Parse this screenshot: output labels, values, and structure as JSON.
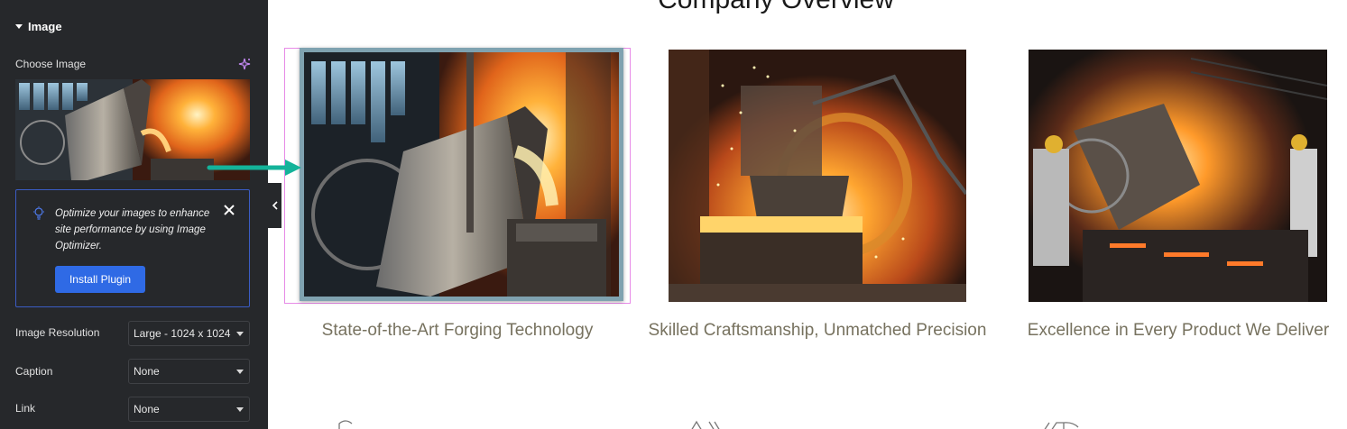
{
  "panel": {
    "section_title": "Image",
    "choose_image_label": "Choose Image",
    "notice": {
      "text": "Optimize your images to enhance site performance by using Image Optimizer.",
      "button_label": "Install Plugin"
    },
    "controls": [
      {
        "label": "Image Resolution",
        "value": "Large - 1024 x 1024"
      },
      {
        "label": "Caption",
        "value": "None"
      },
      {
        "label": "Link",
        "value": "None"
      }
    ]
  },
  "canvas": {
    "heading": "Company Overview",
    "cards": [
      {
        "caption": "State-of-the-Art Forging Technology"
      },
      {
        "caption": "Skilled Craftsmanship, Unmatched Precision"
      },
      {
        "caption": "Excellence in Every Product We Deliver"
      }
    ]
  },
  "icons": {
    "collapse": "chevron-left-icon",
    "close": "close-icon",
    "bulb": "lightbulb-icon",
    "ai": "ai-sparkle-icon"
  },
  "colors": {
    "panel_bg": "#26282b",
    "accent_blue": "#2f6ae5",
    "notice_border": "#3b5cc4",
    "caption_text": "#77725f",
    "selection_outline": "#e78ae7",
    "arrow": "#14b39a"
  }
}
